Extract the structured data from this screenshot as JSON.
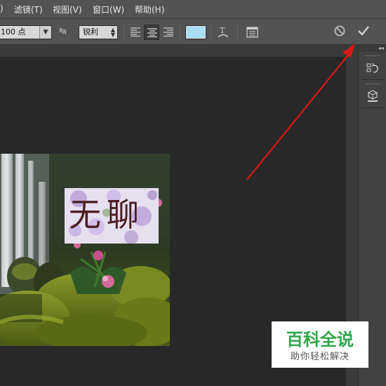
{
  "menu": {
    "items": [
      {
        "label": ")",
        "name": "menu-item-partial"
      },
      {
        "label": "滤镜(T)",
        "name": "menu-item-filter"
      },
      {
        "label": "视图(V)",
        "name": "menu-item-view"
      },
      {
        "label": "窗口(W)",
        "name": "menu-item-window"
      },
      {
        "label": "帮助(H)",
        "name": "menu-item-help"
      }
    ]
  },
  "options": {
    "font_size": "100 点",
    "antialias_icon_text": "ªa",
    "antialias": "锐利",
    "text_color": "#a9def6"
  },
  "canvas": {
    "text_layer": "无聊"
  },
  "watermark": {
    "main": "百科全说",
    "sub": "助你轻松解决"
  },
  "colors": {
    "menubar": "#535353",
    "workspace": "#282828",
    "arrow": "#d81818",
    "watermark_green": "#2ea64a"
  },
  "icons": [
    "align-left-icon",
    "align-center-icon",
    "align-right-icon",
    "warp-text-icon",
    "character-panel-icon",
    "cancel-icon",
    "commit-checkmark-icon",
    "history-panel-icon",
    "3d-panel-icon"
  ]
}
